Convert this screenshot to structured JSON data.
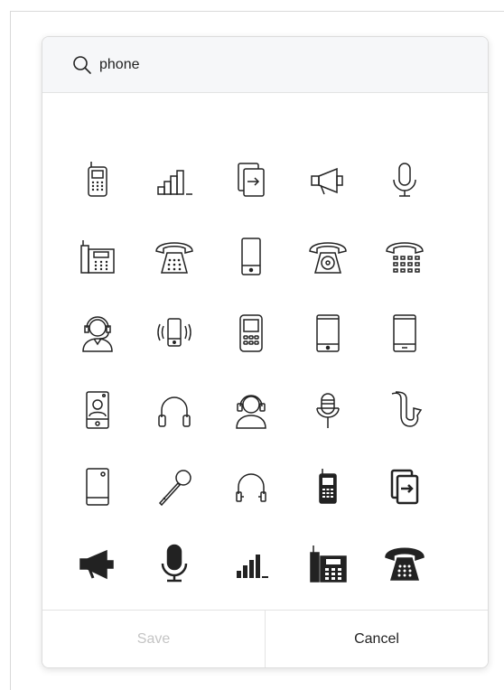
{
  "search": {
    "value": "phone",
    "icon": "search-icon"
  },
  "icons": [
    "mobile-phone-keypad-icon",
    "signal-bars-icon",
    "phone-transfer-icon",
    "megaphone-icon",
    "microphone-icon",
    "desk-phone-icon",
    "rotary-phone-keypad-icon",
    "smartphone-icon",
    "rotary-phone-dial-icon",
    "payphone-icon",
    "call-center-agent-icon",
    "vibrating-phone-icon",
    "feature-phone-icon",
    "tablet-icon",
    "tablet-home-icon",
    "video-call-phone-icon",
    "headphones-icon",
    "headset-user-icon",
    "studio-microphone-icon",
    "saxophone-icon",
    "phone-back-camera-icon",
    "handheld-microphone-icon",
    "headphones-thin-icon",
    "mobile-phone-filled-icon",
    "phone-transfer-filled-icon",
    "megaphone-filled-icon",
    "microphone-filled-icon",
    "signal-bars-filled-icon",
    "desk-phone-filled-icon",
    "rotary-phone-filled-icon"
  ],
  "footer": {
    "save_label": "Save",
    "cancel_label": "Cancel"
  },
  "colors": {
    "icon_stroke": "#222222",
    "disabled_text": "#c4c4c4",
    "header_bg": "#f6f7f9"
  }
}
